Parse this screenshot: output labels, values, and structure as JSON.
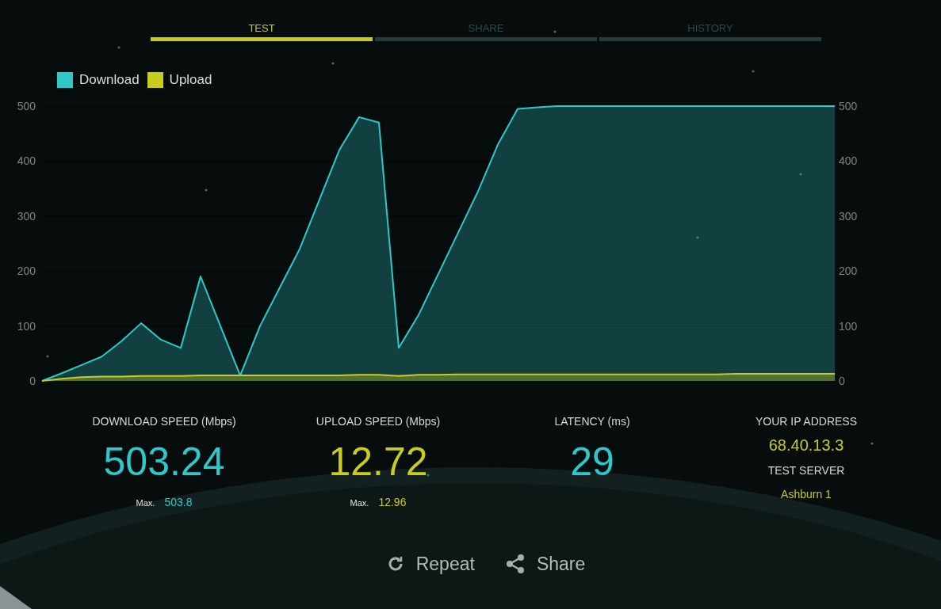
{
  "tabs": [
    {
      "label": "TEST",
      "selected": true
    },
    {
      "label": "SHARE",
      "selected": false
    },
    {
      "label": "HISTORY",
      "selected": false
    }
  ],
  "chart": {
    "chart_data": {
      "type": "area",
      "categories": [
        null,
        null,
        null,
        null,
        null,
        null,
        null,
        null,
        null,
        null,
        null,
        null,
        null,
        null,
        null,
        null,
        null,
        null,
        null,
        null,
        null,
        null,
        null,
        null,
        null,
        null,
        null,
        null,
        null,
        null,
        null,
        null,
        null,
        null,
        null,
        null,
        null,
        null,
        null,
        null,
        null
      ],
      "ylim": [
        0,
        500
      ],
      "yticks": [
        0,
        100,
        200,
        300,
        400,
        500
      ],
      "y2ticks": [
        0,
        100,
        200,
        300,
        400,
        500
      ],
      "y2lim": [
        0,
        500
      ],
      "grid": true,
      "series": [
        {
          "name": "Download",
          "color": "#2ec8c8",
          "values": [
            0,
            14,
            29,
            44,
            72,
            105,
            75,
            60,
            190,
            100,
            10,
            100,
            170,
            240,
            330,
            420,
            480,
            470,
            60,
            120,
            195,
            270,
            345,
            430,
            495,
            498,
            500,
            500,
            500,
            500,
            500,
            500,
            500,
            500,
            500,
            500,
            500,
            500,
            500,
            500,
            500
          ]
        },
        {
          "name": "Upload",
          "color": "#c8cc1a",
          "values": [
            0,
            4,
            7,
            8,
            8,
            9,
            9,
            9,
            10,
            10,
            10,
            10,
            10,
            10,
            10,
            10,
            11,
            11,
            9,
            11,
            11,
            12,
            12,
            12,
            12,
            12,
            12,
            12,
            12,
            12,
            12,
            12,
            12,
            12,
            12,
            13,
            13,
            13,
            13,
            13,
            13
          ]
        }
      ]
    }
  },
  "stats": [
    {
      "kind": "speed",
      "label": "DOWNLOAD SPEED (Mbps)",
      "value": "503.24",
      "max_label": "Max.",
      "max_value": "503.8",
      "color": "#2ec8c8"
    },
    {
      "kind": "speed",
      "label": "UPLOAD SPEED (Mbps)",
      "value": "12.72",
      "max_label": "Max.",
      "max_value": "12.96",
      "color": "#c8cc1a"
    },
    {
      "kind": "speed",
      "label": "LATENCY (ms)",
      "value": "29",
      "color": "#2ec8c8"
    },
    {
      "kind": "info",
      "label": "YOUR IP ADDRESS",
      "value": "68.40.13.3",
      "label2": "TEST SERVER",
      "value2": "Ashburn 1",
      "color": "#c8cc1a"
    }
  ],
  "actions": [
    {
      "kind": "repeat",
      "label": "Repeat"
    },
    {
      "kind": "share",
      "label": "Share"
    }
  ]
}
